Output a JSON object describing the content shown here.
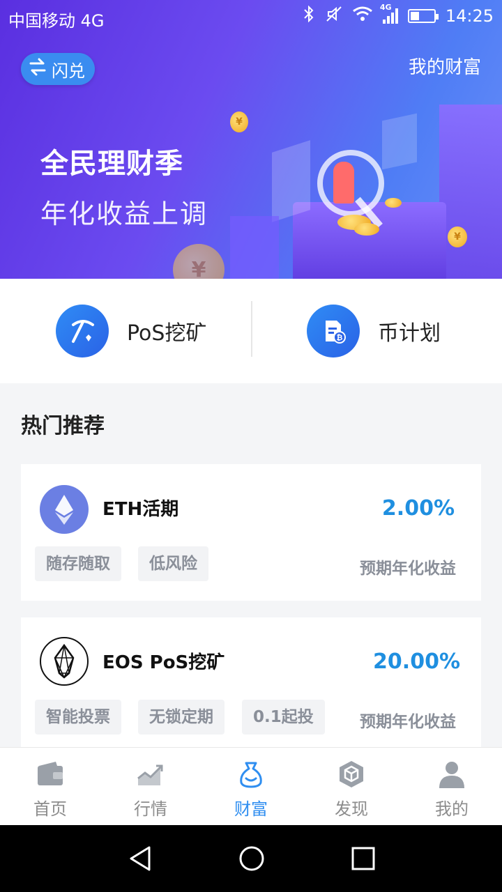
{
  "status_bar": {
    "carrier": "中国移动 4G",
    "network_badge": "4G",
    "time": "14:25",
    "icons": [
      "image-icon",
      "bluetooth-icon",
      "mute-icon",
      "wifi-icon",
      "signal-icon",
      "battery-icon"
    ]
  },
  "header": {
    "exchange_label": "闪兑",
    "my_wealth_label": "我的财富"
  },
  "banner": {
    "title": "全民理财季",
    "subtitle": "年化收益上调",
    "coin_symbol": "¥",
    "colors": {
      "start": "#5a2fe0",
      "end": "#4f7df5"
    }
  },
  "quick_entries": [
    {
      "label": "PoS挖矿",
      "icon": "pickaxe-icon"
    },
    {
      "label": "币计划",
      "icon": "bitcoin-document-icon"
    }
  ],
  "section": {
    "title": "热门推荐"
  },
  "products": [
    {
      "name": "ETH活期",
      "rate": "2.00%",
      "tags": [
        "随存随取",
        "低风险"
      ],
      "caption": "预期年化收益",
      "logo": "ethereum-logo-icon"
    },
    {
      "name": "EOS PoS挖矿",
      "rate": "20.00%",
      "tags": [
        "智能投票",
        "无锁定期",
        "0.1起投"
      ],
      "caption": "预期年化收益",
      "logo": "eos-logo-icon"
    }
  ],
  "tab_bar": {
    "items": [
      {
        "label": "首页",
        "icon": "wallet-icon"
      },
      {
        "label": "行情",
        "icon": "chart-trend-icon"
      },
      {
        "label": "财富",
        "icon": "money-bag-icon"
      },
      {
        "label": "发现",
        "icon": "cube-icon"
      },
      {
        "label": "我的",
        "icon": "person-icon"
      }
    ],
    "active_index": 2,
    "active_color": "#2f8ef0"
  },
  "system_nav": {
    "icons": [
      "back-icon",
      "home-icon",
      "recents-icon"
    ]
  }
}
